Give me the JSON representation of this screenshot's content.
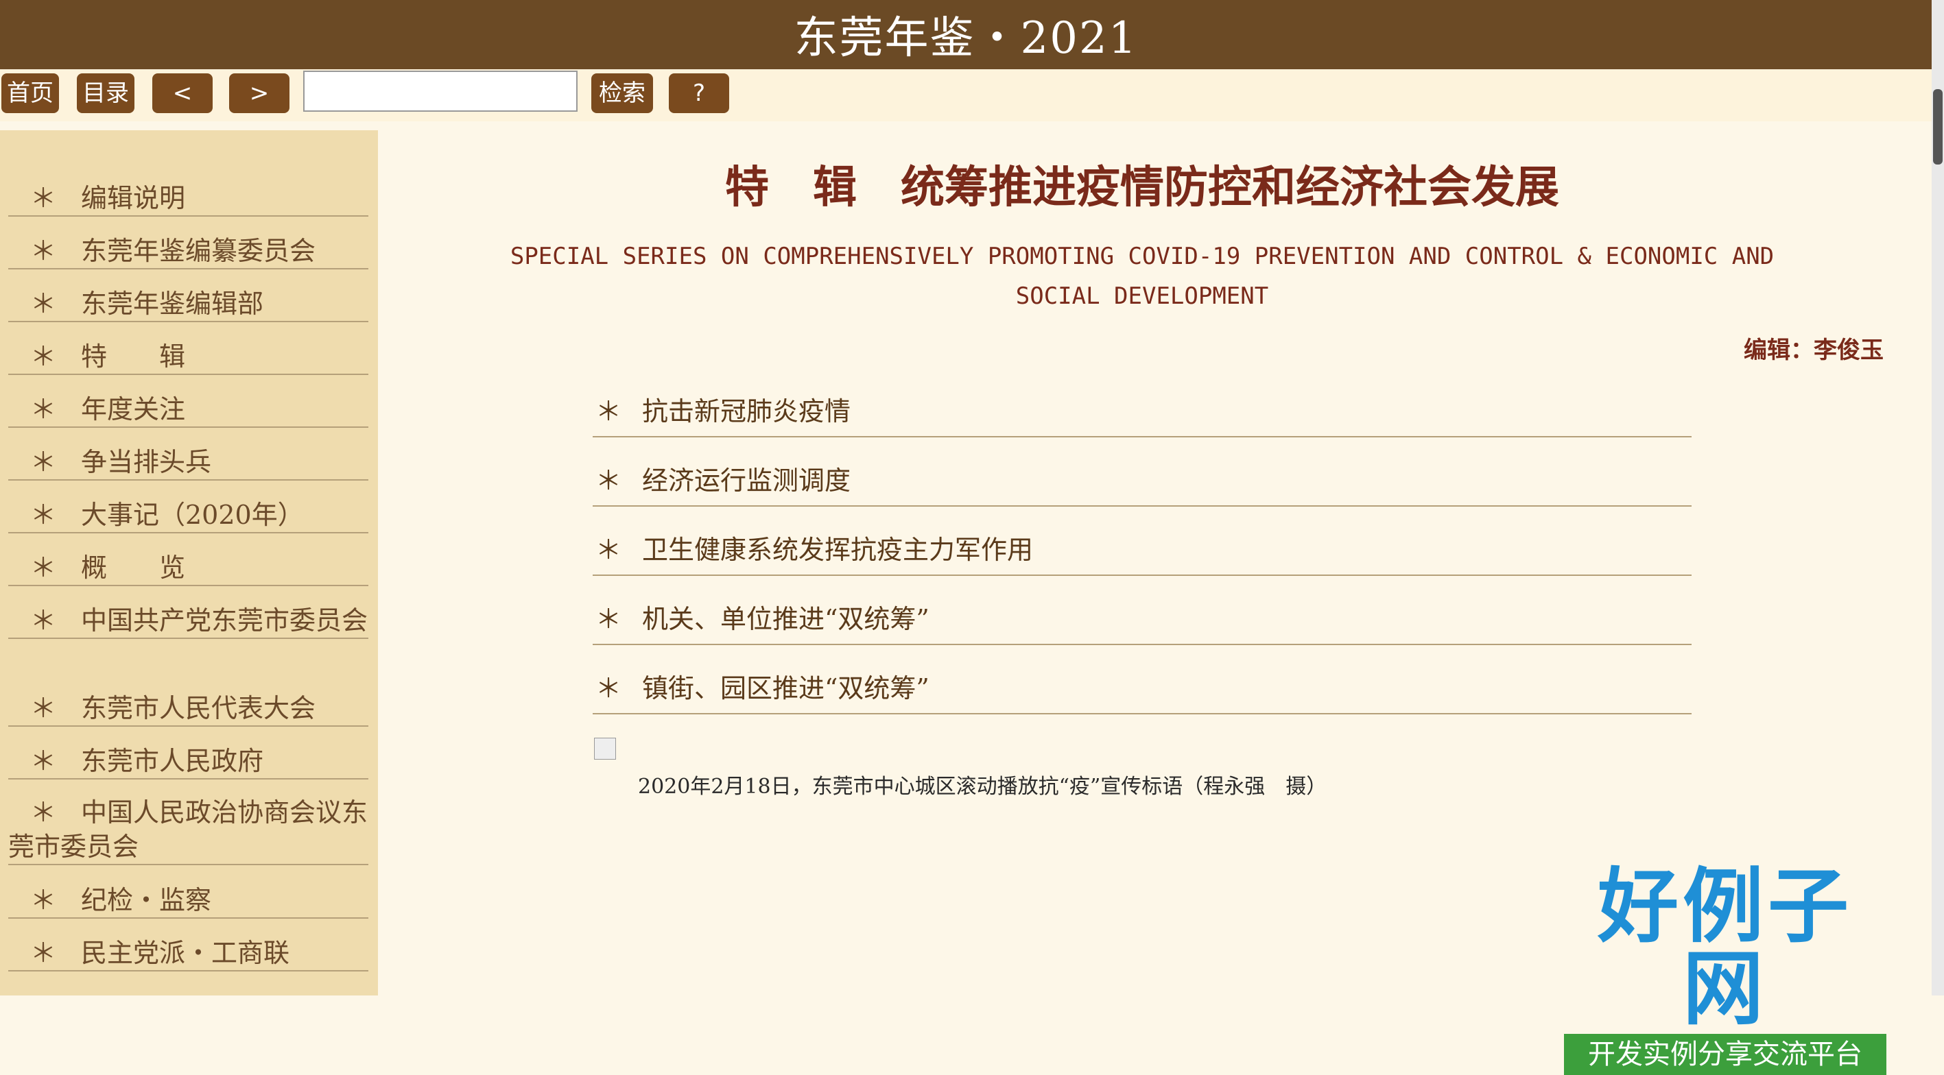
{
  "header": {
    "title": "东莞年鉴・2021"
  },
  "toolbar": {
    "home": "首页",
    "contents": "目录",
    "prev": "<",
    "next": ">",
    "search_value": "",
    "search_button": "检索",
    "help": "?"
  },
  "sidebar": {
    "star": "＊",
    "items": [
      "编辑说明",
      "东莞年鉴编纂委员会",
      "东莞年鉴编辑部",
      "特　　辑",
      "年度关注",
      "争当排头兵",
      "大事记（2020年）",
      "概　　览",
      "中国共产党东莞市委员会",
      "东莞市人民代表大会",
      "东莞市人民政府",
      "中国人民政治协商会议东莞市委员会",
      "纪检・监察",
      "民主党派・工商联"
    ]
  },
  "main": {
    "title": "特　辑　统筹推进疫情防控和经济社会发展",
    "subtitle": "SPECIAL SERIES ON COMPREHENSIVELY PROMOTING COVID-19 PREVENTION AND CONTROL & ECONOMIC AND SOCIAL DEVELOPMENT",
    "editor": "编辑：李俊玉",
    "star": "＊",
    "topics": [
      "抗击新冠肺炎疫情",
      "经济运行监测调度",
      "卫生健康系统发挥抗疫主力军作用",
      "机关、单位推进“双统筹”",
      "镇街、园区推进“双统筹”"
    ],
    "caption": "2020年2月18日，东莞市中心城区滚动播放抗“疫”宣传标语（程永强　摄）"
  },
  "logo": {
    "main": "好例子网",
    "sub": "开发实例分享交流平台"
  },
  "colors": {
    "header_bg": "#6b4a25",
    "sidebar_bg": "#efdcae",
    "page_bg": "#fdf7e8",
    "button_bg": "#7a4a1e",
    "title_color": "#7a2a1a"
  }
}
